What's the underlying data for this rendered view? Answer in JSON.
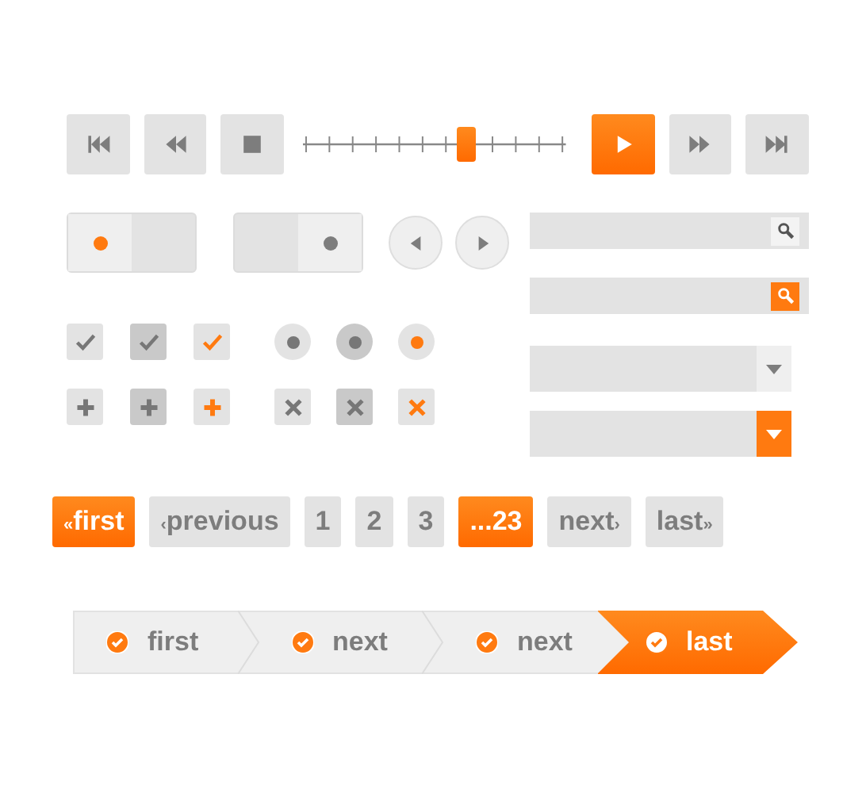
{
  "media": {
    "buttons": [
      {
        "kind": "skip-back",
        "selected": false
      },
      {
        "kind": "rewind",
        "selected": false
      },
      {
        "kind": "stop",
        "selected": false
      }
    ],
    "slider": {
      "level": 0.62
    },
    "buttons_right": [
      {
        "kind": "play",
        "selected": true
      },
      {
        "kind": "forward",
        "selected": false
      },
      {
        "kind": "skip-forward",
        "selected": false
      }
    ]
  },
  "toggles": [
    {
      "on": false,
      "highlighted": true
    },
    {
      "on": true,
      "highlighted": false
    }
  ],
  "arrows": [
    {
      "kind": "prev"
    },
    {
      "kind": "next"
    }
  ],
  "searches": [
    {
      "active": false
    },
    {
      "active": true
    }
  ],
  "dropdowns": [
    {
      "active": false
    },
    {
      "active": true
    }
  ],
  "checkboxes": [
    {
      "checked": true,
      "pressed": false,
      "highlighted": false
    },
    {
      "checked": true,
      "pressed": true,
      "highlighted": false
    },
    {
      "checked": true,
      "pressed": false,
      "highlighted": true
    }
  ],
  "radios": [
    {
      "selected": true,
      "pressed": false,
      "highlighted": false
    },
    {
      "selected": true,
      "pressed": true,
      "highlighted": false
    },
    {
      "selected": true,
      "pressed": false,
      "highlighted": true
    }
  ],
  "plus_buttons": [
    {
      "pressed": false,
      "selected": false
    },
    {
      "pressed": true,
      "selected": false
    },
    {
      "pressed": false,
      "selected": true
    }
  ],
  "close_buttons": [
    {
      "pressed": false,
      "selected": false
    },
    {
      "pressed": true,
      "selected": false
    },
    {
      "pressed": false,
      "selected": true
    }
  ],
  "pagination": [
    {
      "prefix": "«",
      "label": "first",
      "active": true
    },
    {
      "prefix": "‹",
      "label": "previous",
      "active": false
    },
    {
      "label": "1",
      "active": false
    },
    {
      "label": "2",
      "active": false
    },
    {
      "label": "3",
      "active": false
    },
    {
      "label": "...23",
      "active": true
    },
    {
      "label": "next",
      "suffix": "›",
      "active": false
    },
    {
      "label": "last",
      "suffix": "»",
      "active": false
    }
  ],
  "steps": [
    {
      "label": "first",
      "selected": false
    },
    {
      "label": "next",
      "selected": false
    },
    {
      "label": "next",
      "selected": false
    },
    {
      "label": "last",
      "selected": true
    }
  ]
}
